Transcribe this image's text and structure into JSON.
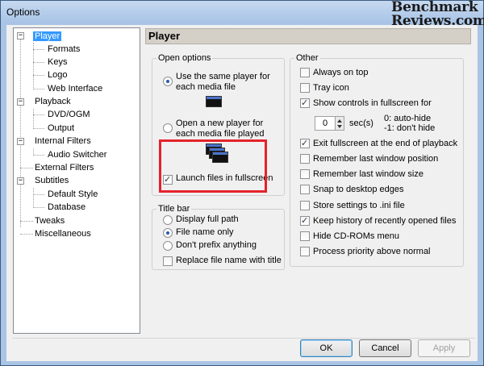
{
  "window": {
    "title": "Options"
  },
  "watermark": {
    "line1": "Benchmark",
    "line2": "Reviews.com"
  },
  "tree": [
    {
      "label": "Player",
      "selected": true
    },
    {
      "label": "Formats"
    },
    {
      "label": "Keys"
    },
    {
      "label": "Logo"
    },
    {
      "label": "Web Interface"
    },
    {
      "label": "Playback"
    },
    {
      "label": "DVD/OGM"
    },
    {
      "label": "Output"
    },
    {
      "label": "Internal Filters"
    },
    {
      "label": "Audio Switcher"
    },
    {
      "label": "External Filters"
    },
    {
      "label": "Subtitles"
    },
    {
      "label": "Default Style"
    },
    {
      "label": "Database"
    },
    {
      "label": "Tweaks"
    },
    {
      "label": "Miscellaneous"
    }
  ],
  "panel": {
    "title": "Player"
  },
  "open_options": {
    "legend": "Open options",
    "same_player": {
      "line1": "Use the same player for",
      "line2": "each media file",
      "checked": true
    },
    "new_player": {
      "line1": "Open a new player for",
      "line2": "each media file played",
      "checked": false
    },
    "launch_fullscreen": {
      "label": "Launch files in fullscreen",
      "checked": true
    }
  },
  "title_bar": {
    "legend": "Title bar",
    "options": [
      {
        "label": "Display full path",
        "checked": false
      },
      {
        "label": "File name only",
        "checked": true
      },
      {
        "label": "Don't prefix anything",
        "checked": false
      }
    ],
    "replace": {
      "label": "Replace file name with title",
      "checked": false
    }
  },
  "other": {
    "legend": "Other",
    "always_on_top": {
      "label": "Always on top",
      "checked": false
    },
    "tray_icon": {
      "label": "Tray icon",
      "checked": false
    },
    "show_controls": {
      "label": "Show controls in fullscreen for",
      "checked": true
    },
    "spin_value": "0",
    "sec_label": "sec(s)",
    "hint1": "0: auto-hide",
    "hint2": "-1: don't hide",
    "items": [
      {
        "label": "Exit fullscreen at the end of playback",
        "checked": true
      },
      {
        "label": "Remember last window position",
        "checked": false
      },
      {
        "label": "Remember last window size",
        "checked": false
      },
      {
        "label": "Snap to desktop edges",
        "checked": false
      },
      {
        "label": "Store settings to .ini file",
        "checked": false
      },
      {
        "label": "Keep history of recently opened files",
        "checked": true
      },
      {
        "label": "Hide CD-ROMs menu",
        "checked": false
      },
      {
        "label": "Process priority above normal",
        "checked": false
      }
    ]
  },
  "buttons": {
    "ok": "OK",
    "cancel": "Cancel",
    "apply": "Apply"
  }
}
